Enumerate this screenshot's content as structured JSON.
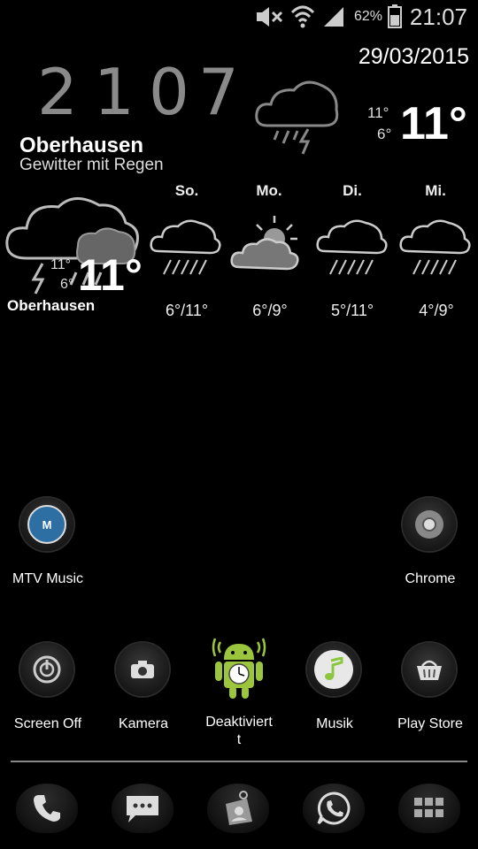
{
  "status_bar": {
    "battery_percent": "62%",
    "time": "21:07",
    "icons": [
      "mute-icon",
      "wifi-icon",
      "signal-icon",
      "battery-icon"
    ]
  },
  "clock": {
    "digits": [
      "2",
      "1",
      "0",
      "7"
    ],
    "date": "29/03/2015"
  },
  "weather_top": {
    "temp_max": "11°",
    "temp_min": "6°",
    "temp_current": "11°",
    "city": "Oberhausen",
    "condition": "Gewitter mit Regen",
    "icon": "thunderstorm-icon"
  },
  "forecast": [
    {
      "day": "So.",
      "temps": "6°/11°",
      "icon": "rain-icon"
    },
    {
      "day": "Mo.",
      "temps": "6°/9°",
      "icon": "partly-cloudy-icon"
    },
    {
      "day": "Di.",
      "temps": "5°/11°",
      "icon": "rain-icon"
    },
    {
      "day": "Mi.",
      "temps": "4°/9°",
      "icon": "rain-icon"
    }
  ],
  "weather_small": {
    "temp_max": "11°",
    "temp_min": "6°",
    "temp_current": "11°",
    "city": "Oberhausen",
    "icon": "thunderstorm-icon"
  },
  "apps": {
    "mtv": {
      "label": "MTV Music",
      "icon": "mtv-icon"
    },
    "chrome": {
      "label": "Chrome",
      "icon": "chrome-icon"
    },
    "screen_off": {
      "label": "Screen Off",
      "icon": "power-icon"
    },
    "kamera": {
      "label": "Kamera",
      "icon": "camera-icon"
    },
    "deaktiviert": {
      "label_line1": "Deaktiviert",
      "label_line2": "t",
      "icon": "android-alarm-icon"
    },
    "musik": {
      "label": "Musik",
      "icon": "music-note-icon"
    },
    "play_store": {
      "label": "Play Store",
      "icon": "shopping-basket-icon"
    }
  },
  "dock": [
    "phone-icon",
    "messages-icon",
    "contacts-icon",
    "whatsapp-icon",
    "app-drawer-icon"
  ],
  "colors": {
    "background": "#000000",
    "clock_digits": "#8a8a8a",
    "android_green": "#9bc53d",
    "music_green": "#8cc63f",
    "mtv_blue": "#2e6fa3"
  }
}
